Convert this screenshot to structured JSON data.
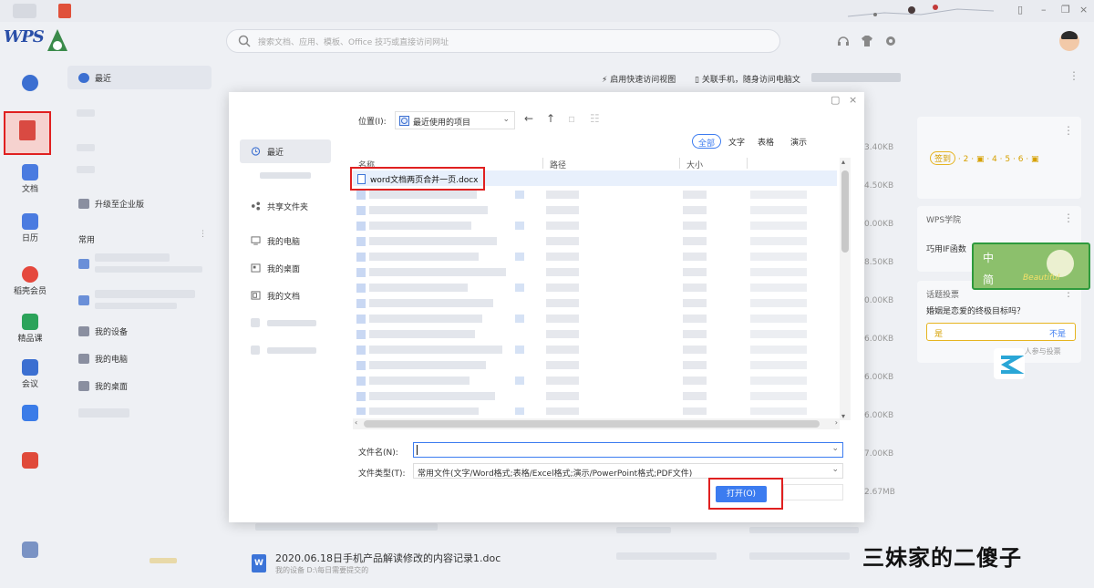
{
  "search": {
    "placeholder": "搜索文档、应用、模板、Office 技巧或直接访问网址"
  },
  "nav": {
    "docs": "文档",
    "calendar": "日历",
    "member": "稻壳会员",
    "course": "精品课",
    "meeting": "会议"
  },
  "panel2": {
    "recent": "最近",
    "upgrade": "升级至企业版",
    "common": "常用",
    "my_devices": "我的设备",
    "my_computer": "我的电脑",
    "my_desktop": "我的桌面"
  },
  "main": {
    "quick_view": "启用快速访问视图",
    "link_phone": "关联手机，随身访问电脑文",
    "sizes": [
      "3.40KB",
      "4.50KB",
      "0.00KB",
      "8.50KB",
      "0.00KB",
      "6.00KB",
      "6.00KB",
      "6.00KB",
      "7.00KB",
      "2.67MB"
    ],
    "doc_title": "2020.06.18日手机产品解读修改的内容记录1.doc",
    "doc_sub": "我的设备 D:\\每日需要提交的"
  },
  "right": {
    "sign": "签到",
    "days": [
      "2",
      "4",
      "5",
      "6"
    ],
    "academy": "WPS学院",
    "academy_text": "巧用IF函数",
    "topic": "话题投票",
    "question": "婚姻是恋爱的终极目标吗？",
    "yes": "是",
    "no": "不是",
    "count": "9 人参与投票"
  },
  "ime": {
    "a": "中",
    "b": "简",
    "c": "Beautiful"
  },
  "watermark": "三妹家的二傻子",
  "dialog": {
    "sidebar": {
      "recent": "最近",
      "shared": "共享文件夹",
      "computer": "我的电脑",
      "desktop": "我的桌面",
      "documents": "我的文档"
    },
    "location_label": "位置(I):",
    "location_value": "最近使用的项目",
    "filters": [
      "全部",
      "文字",
      "表格",
      "演示"
    ],
    "columns": {
      "name": "名称",
      "path": "路径",
      "size": "大小"
    },
    "selected_file": "word文档两页合并一页.docx",
    "filename_label": "文件名(N):",
    "filetype_label": "文件类型(T):",
    "filetype_value": "常用文件(文字/Word格式;表格/Excel格式;演示/PowerPoint格式;PDF文件)",
    "open_label": "打开(O)"
  },
  "icons": {
    "back": "back-arrow-icon",
    "up": "up-arrow-icon",
    "accent": "#3c7cf0",
    "highlight": "#e02020"
  }
}
